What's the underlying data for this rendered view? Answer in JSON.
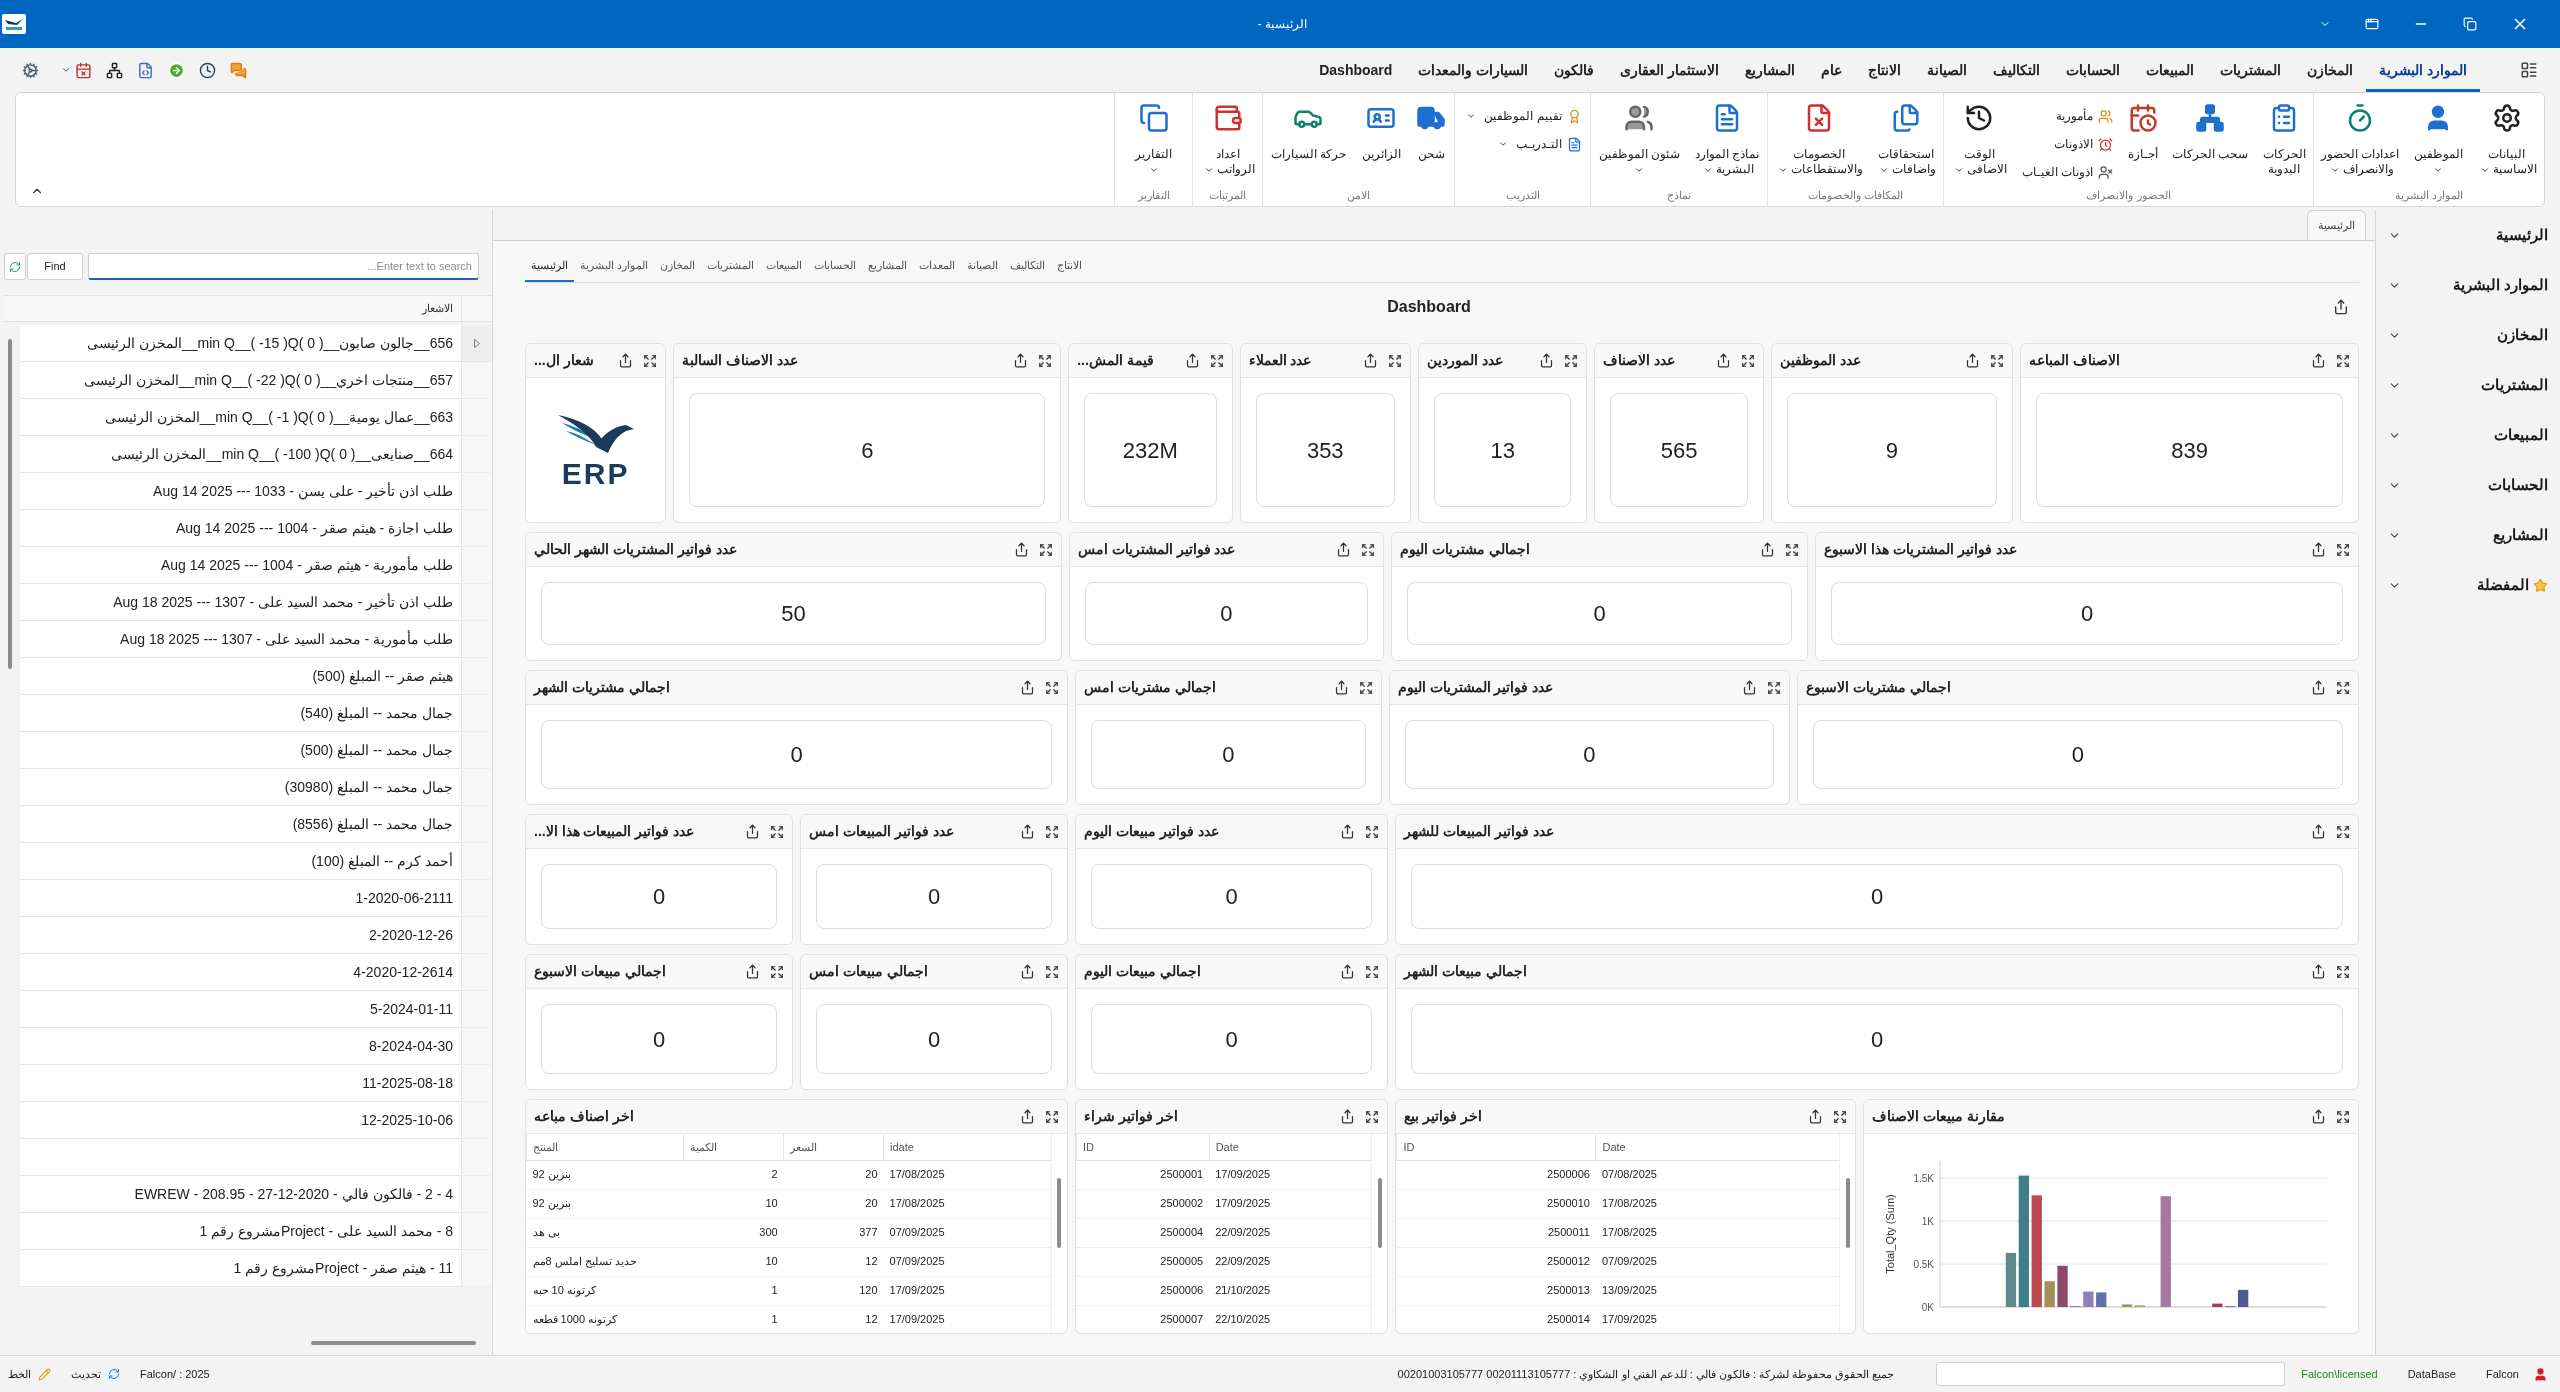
{
  "window": {
    "title": "الرئيسية -"
  },
  "ribbon": {
    "tabs": [
      {
        "label": "الموارد البشرية",
        "selected": true
      },
      {
        "label": "المخازن",
        "selected": false
      },
      {
        "label": "المشتريات",
        "selected": false
      },
      {
        "label": "المبيعات",
        "selected": false
      },
      {
        "label": "الحسابات",
        "selected": false
      },
      {
        "label": "التكاليف",
        "selected": false
      },
      {
        "label": "الصيانة",
        "selected": false
      },
      {
        "label": "الانتاج",
        "selected": false
      },
      {
        "label": "عام",
        "selected": false
      },
      {
        "label": "المشاريع",
        "selected": false
      },
      {
        "label": "الاستثمار العقارى",
        "selected": false
      },
      {
        "label": "فالكون",
        "selected": false
      },
      {
        "label": "السيارات والمعدات",
        "selected": false
      },
      {
        "label": "Dashboard",
        "selected": false
      }
    ],
    "groups": [
      {
        "label": "الموارد البشرية",
        "items": [
          {
            "kind": "large",
            "lines": [
              "البيانات",
              "الاساسية"
            ],
            "dropdown": true
          },
          {
            "kind": "large",
            "lines": [
              "الموظفين"
            ],
            "dropdown": true
          },
          {
            "kind": "large",
            "lines": [
              "اعدادات الحضور",
              "والانصراف"
            ],
            "dropdown": true
          }
        ]
      },
      {
        "label": "الحضور والانصراف",
        "items": [
          {
            "kind": "large",
            "lines": [
              "الحركات",
              "اليدوية"
            ],
            "dropdown": false
          },
          {
            "kind": "large",
            "lines": [
              "سحب الحركات"
            ],
            "dropdown": false
          },
          {
            "kind": "large",
            "lines": [
              "أجـازة"
            ],
            "dropdown": false
          },
          {
            "kind": "stack",
            "entries": [
              {
                "label": "مأمورية",
                "dropdown": false
              },
              {
                "label": "الاذونات",
                "dropdown": false
              },
              {
                "label": "اذونات الغيـاب",
                "dropdown": false
              }
            ]
          },
          {
            "kind": "large",
            "lines": [
              "الوقت",
              "الاضافى"
            ],
            "dropdown": true
          }
        ]
      },
      {
        "label": "المكافات والخصومات",
        "items": [
          {
            "kind": "large",
            "lines": [
              "استحقاقات",
              "واضافات"
            ],
            "dropdown": true
          },
          {
            "kind": "large",
            "lines": [
              "الخصومات",
              "والاستقطاعات"
            ],
            "dropdown": true
          }
        ]
      },
      {
        "label": "نماذج",
        "items": [
          {
            "kind": "large",
            "lines": [
              "نماذج الموارد",
              "البشرية"
            ],
            "dropdown": true
          },
          {
            "kind": "large",
            "lines": [
              "شئون الموظفين"
            ],
            "dropdown": true
          }
        ]
      },
      {
        "label": "التدريب",
        "items": [
          {
            "kind": "stack",
            "entries": [
              {
                "label": "تقييم الموظفين",
                "dropdown": true
              },
              {
                "label": "التـدريـب",
                "dropdown": true
              }
            ]
          }
        ]
      },
      {
        "label": "الامن",
        "items": [
          {
            "kind": "large",
            "lines": [
              "شحن"
            ],
            "dropdown": false
          },
          {
            "kind": "large",
            "lines": [
              "الزائرين"
            ],
            "dropdown": false
          },
          {
            "kind": "large",
            "lines": [
              "حركة السيارات"
            ],
            "dropdown": false
          }
        ]
      },
      {
        "label": "المرتبات",
        "items": [
          {
            "kind": "large",
            "lines": [
              "اعداد",
              "الرواتب"
            ],
            "dropdown": true
          }
        ]
      },
      {
        "label": "التقارير",
        "items": [
          {
            "kind": "large",
            "lines": [
              "التقارير"
            ],
            "dropdown": true
          }
        ]
      }
    ]
  },
  "notifications": {
    "find_button": "Find",
    "search": {
      "placeholder": "Enter text to search..."
    },
    "column": "الاشعار",
    "rows": [
      {
        "kind": "text",
        "text": "656__جالون صابون__min Q__( -15 )Q( 0 )__المخزن الرئيسى",
        "selected": true
      },
      {
        "kind": "text",
        "text": "657__منتجات اخري__min Q__( -22 )Q( 0 )__المخزن الرئيسى",
        "selected": false
      },
      {
        "kind": "text",
        "text": "663__عمال يومية__min Q__( -1 )Q( 0 )__المخزن الرئيسى",
        "selected": false
      },
      {
        "kind": "text",
        "text": "664__صنايعى__min Q__( -100 )Q( 0 )__المخزن الرئيسى",
        "selected": false
      },
      {
        "kind": "text",
        "text": "طلب اذن تأخير - على يسن - 1033 --- Aug 14 2025",
        "selected": false
      },
      {
        "kind": "text",
        "text": "طلب اجازة - هيثم صقر - 1004 --- Aug 14 2025",
        "selected": false
      },
      {
        "kind": "text",
        "text": "طلب مأمورية - هيثم صقر - 1004 --- Aug 14 2025",
        "selected": false
      },
      {
        "kind": "text",
        "text": "طلب اذن تأخير - محمد السيد على  - 1307 --- Aug 18 2025",
        "selected": false
      },
      {
        "kind": "text",
        "text": "طلب مأمورية - محمد السيد على  - 1307 --- Aug 18 2025",
        "selected": false
      },
      {
        "kind": "text",
        "text": "هيثم صقر --  المبلغ  (500)",
        "selected": false
      },
      {
        "kind": "text",
        "text": "جمال محمد --  المبلغ  (540)",
        "selected": false
      },
      {
        "kind": "text",
        "text": "جمال محمد --  المبلغ  (500)",
        "selected": false
      },
      {
        "kind": "text",
        "text": "جمال محمد --  المبلغ  (30980)",
        "selected": false
      },
      {
        "kind": "text",
        "text": "جمال محمد --  المبلغ  (8556)",
        "selected": false
      },
      {
        "kind": "text",
        "text": "أحمد كرم --  المبلغ  (100)",
        "selected": false
      },
      {
        "kind": "text",
        "text": "1-2020-06-2111",
        "selected": false
      },
      {
        "kind": "text",
        "text": "2-2020-12-26",
        "selected": false
      },
      {
        "kind": "text",
        "text": "4-2020-12-2614",
        "selected": false
      },
      {
        "kind": "text",
        "text": "5-2024-01-11",
        "selected": false
      },
      {
        "kind": "text",
        "text": "8-2024-04-30",
        "selected": false
      },
      {
        "kind": "text",
        "text": "11-2025-08-18",
        "selected": false
      },
      {
        "kind": "text",
        "text": "12-2025-10-06",
        "selected": false
      },
      {
        "kind": "blank",
        "selected": false
      },
      {
        "kind": "text",
        "text": "4 - 2 - فالكون فالي - 2020-12-27 - 208.95 - EWREW",
        "selected": false
      },
      {
        "kind": "text",
        "text": "8 - محمد السيد على  - Projectمشروع رقم 1",
        "selected": false
      },
      {
        "kind": "text",
        "text": "11 - هيثم صقر - Projectمشروع رقم 1",
        "selected": false
      }
    ]
  },
  "document_tabs": [
    {
      "label": "الرئيسية",
      "selected": true
    }
  ],
  "dashboard": {
    "tabs": [
      {
        "label": "الانتاج",
        "selected": false
      },
      {
        "label": "التكاليف",
        "selected": false
      },
      {
        "label": "الصيانة",
        "selected": false
      },
      {
        "label": "المعدات",
        "selected": false
      },
      {
        "label": "المشاريع",
        "selected": false
      },
      {
        "label": "الحسابات",
        "selected": false
      },
      {
        "label": "المبيعات",
        "selected": false
      },
      {
        "label": "المشتريات",
        "selected": false
      },
      {
        "label": "المخازن",
        "selected": false
      },
      {
        "label": "الموارد البشرية",
        "selected": false
      },
      {
        "label": "الرئيسية",
        "selected": true
      }
    ],
    "title": "Dashboard",
    "rows": [
      {
        "cards": [
          {
            "kind": "value",
            "title": "الاصناف المباعه",
            "value": "839"
          },
          {
            "kind": "value",
            "title": "عدد الموظفين",
            "value": "9"
          },
          {
            "kind": "value",
            "title": "عدد الاصناف",
            "value": "565"
          },
          {
            "kind": "value",
            "title": "عدد الموردين",
            "value": "13"
          },
          {
            "kind": "value",
            "title": "عدد العملاء",
            "value": "353"
          },
          {
            "kind": "value",
            "title": "قيمة المش...",
            "value": "232M"
          },
          {
            "kind": "value",
            "title": "عدد الاصناف السالبة",
            "value": "6"
          },
          {
            "kind": "logo",
            "title": "شعار ال...",
            "logo_text": "ERP"
          }
        ]
      },
      {
        "cards": [
          {
            "kind": "value",
            "title": "عدد فواتير المشتريات هذا الاسبوع",
            "value": "0"
          },
          {
            "kind": "value",
            "title": "اجمالي مشتريات اليوم",
            "value": "0"
          },
          {
            "kind": "value",
            "title": "عدد فواتير المشتريات امس",
            "value": "0"
          },
          {
            "kind": "value",
            "title": "عدد فواتير المشتريات الشهر الحالي",
            "value": "50"
          }
        ]
      },
      {
        "cards": [
          {
            "kind": "value",
            "title": "اجمالي مشتريات الاسبوع",
            "value": "0"
          },
          {
            "kind": "value",
            "title": "عدد فواتير المشتريات اليوم",
            "value": "0"
          },
          {
            "kind": "value",
            "title": "اجمالي مشتريات امس",
            "value": "0"
          },
          {
            "kind": "value",
            "title": "اجمالي مشتريات الشهر",
            "value": "0"
          }
        ]
      },
      {
        "cards": [
          {
            "kind": "value",
            "title": "عدد فواتير المبيعات للشهر",
            "value": "0"
          },
          {
            "kind": "value",
            "title": "عدد فواتير مبيعات اليوم",
            "value": "0"
          },
          {
            "kind": "value",
            "title": "عدد فواتير المبيعات امس",
            "value": "0"
          },
          {
            "kind": "value",
            "title": "عدد فواتير المبيعات هذا الا...",
            "value": "0"
          }
        ]
      },
      {
        "cards": [
          {
            "kind": "value",
            "title": "اجمالي مبيعات الشهر",
            "value": "0"
          },
          {
            "kind": "value",
            "title": "اجمالي مبيعات اليوم",
            "value": "0"
          },
          {
            "kind": "value",
            "title": "اجمالي مبيعات امس",
            "value": "0"
          },
          {
            "kind": "value",
            "title": "اجمالي مبيعات الاسبوع",
            "value": "0"
          }
        ]
      },
      {
        "cards": [
          {
            "kind": "chart",
            "title": "مقارنة مبيعات الاصناف",
            "chart_data": {
              "type": "bar",
              "ylabel": "Total_Qty (Sum)",
              "grid": true,
              "categories": [
                null,
                null,
                null,
                null,
                null,
                null,
                null,
                null,
                null,
                null,
                null,
                null,
                null,
                null,
                null,
                null,
                null,
                null,
                null,
                null,
                null,
                null,
                null,
                null,
                null,
                null,
                null,
                null,
                null,
                null
              ],
              "values": [
                0,
                0,
                0,
                0,
                0,
                630,
                1530,
                1300,
                300,
                480,
                10,
                180,
                170,
                0,
                30,
                20,
                0,
                1290,
                0,
                0,
                0,
                40,
                10,
                200,
                0,
                0,
                0,
                0,
                0,
                0
              ],
              "colors": [
                null,
                null,
                null,
                null,
                null,
                "#5f8a8b",
                "#3f7f8c",
                "#c04852",
                "#a68c55",
                "#8c4a6a",
                "#7a6a9a",
                "#8f80b8",
                "#5f73a8",
                null,
                "#95a045",
                "#b8a25a",
                null,
                "#a4789f",
                null,
                null,
                null,
                "#a0405a",
                "#7c5aa8",
                "#4d5a94",
                null,
                null,
                null,
                null,
                null,
                null
              ],
              "ylim": [
                0,
                1700
              ],
              "yticks": [
                {
                  "value": 0,
                  "label": "0K"
                },
                {
                  "value": 500,
                  "label": "0.5K"
                },
                {
                  "value": 1000,
                  "label": "1K"
                },
                {
                  "value": 1500,
                  "label": "1.5K"
                }
              ]
            }
          },
          {
            "kind": "table",
            "title": "اخر فواتير بيع",
            "columns": [
              {
                "label": "Date",
                "kind": "date"
              },
              {
                "label": "ID",
                "kind": "number"
              }
            ],
            "rows": [
              [
                "07/08/2025",
                "2500006"
              ],
              [
                "17/08/2025",
                "2500010"
              ],
              [
                "17/08/2025",
                "2500011"
              ],
              [
                "07/09/2025",
                "2500012"
              ],
              [
                "13/09/2025",
                "2500013"
              ],
              [
                "17/09/2025",
                "2500014"
              ]
            ]
          },
          {
            "kind": "table",
            "title": "اخر فواتير شراء",
            "columns": [
              {
                "label": "Date",
                "kind": "date"
              },
              {
                "label": "ID",
                "kind": "number"
              }
            ],
            "rows": [
              [
                "17/09/2025",
                "2500001"
              ],
              [
                "17/09/2025",
                "2500002"
              ],
              [
                "22/09/2025",
                "2500004"
              ],
              [
                "22/09/2025",
                "2500005"
              ],
              [
                "21/10/2025",
                "2500006"
              ],
              [
                "22/10/2025",
                "2500007"
              ]
            ]
          },
          {
            "kind": "table",
            "title": "اخر اصناف مباعه",
            "columns": [
              {
                "label": "idate",
                "kind": "date"
              },
              {
                "label": "السعر",
                "kind": "number"
              },
              {
                "label": "الكمية",
                "kind": "number"
              },
              {
                "label": "المنتج",
                "kind": "text"
              }
            ],
            "rows": [
              [
                "17/08/2025",
                "20",
                "2",
                "بنزين 92"
              ],
              [
                "17/08/2025",
                "20",
                "10",
                "بنزين 92"
              ],
              [
                "07/09/2025",
                "377",
                "300",
                "بى هد"
              ],
              [
                "07/09/2025",
                "12",
                "10",
                "حديد تسليح املس 8مم"
              ],
              [
                "17/09/2025",
                "120",
                "1",
                "كرتونه 10 حبه"
              ],
              [
                "17/09/2025",
                "12",
                "1",
                "كرتونه 1000 قطعه"
              ]
            ]
          }
        ]
      }
    ]
  },
  "sidebar": {
    "items": [
      {
        "kind": "section",
        "label": "الرئيسية",
        "expanded": false
      },
      {
        "kind": "section",
        "label": "الموارد البشرية",
        "expanded": false
      },
      {
        "kind": "section",
        "label": "المخازن",
        "expanded": false
      },
      {
        "kind": "section",
        "label": "المشتريات",
        "expanded": false
      },
      {
        "kind": "section",
        "label": "المبيعات",
        "expanded": false
      },
      {
        "kind": "section",
        "label": "الحسابات",
        "expanded": false
      },
      {
        "kind": "section",
        "label": "المشاريع",
        "expanded": false
      },
      {
        "kind": "favorites",
        "label": "المفضلة",
        "expanded": false
      }
    ]
  },
  "status_bar": {
    "left": [
      {
        "kind": "text",
        "label": "Falcon/ : 2025"
      },
      {
        "kind": "refresh",
        "label": "تحديث"
      },
      {
        "kind": "font",
        "label": "الخط"
      }
    ],
    "copyright": "جميع الحقوق محفوظة لشركة : فالكون فالي : للدعم الفني او الشكاوي : 00201113105777   00201003105777",
    "right": [
      {
        "kind": "user",
        "label": "Falcon"
      },
      {
        "kind": "text",
        "label": "DataBase"
      },
      {
        "kind": "license",
        "label": "Falcon\\licensed"
      }
    ]
  }
}
